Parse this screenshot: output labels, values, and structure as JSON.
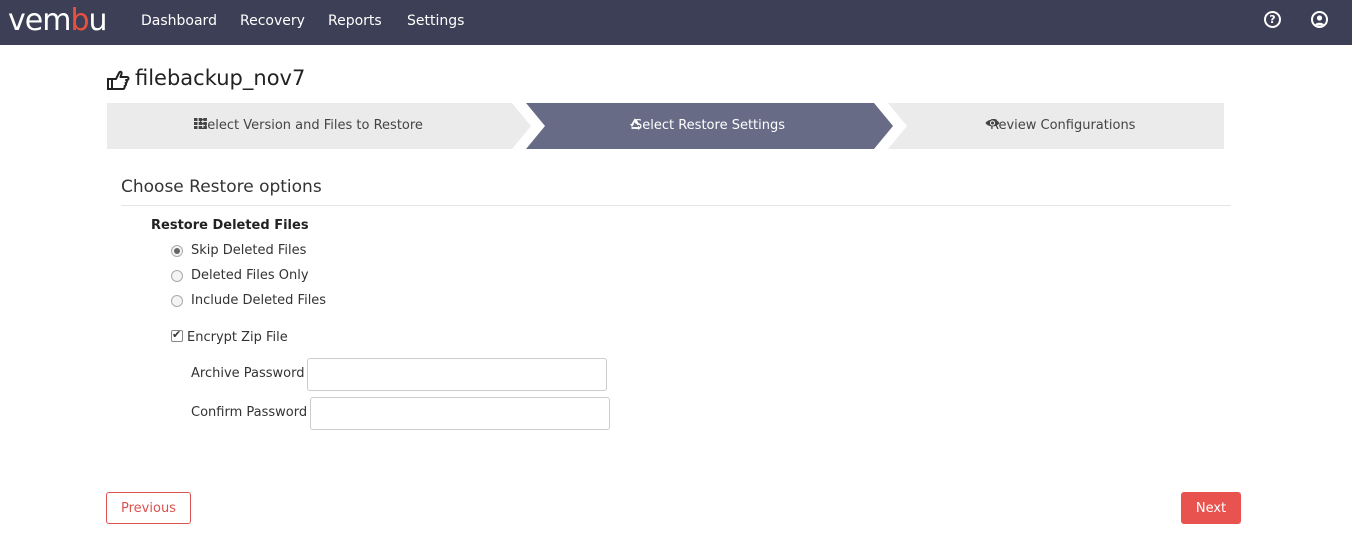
{
  "header": {
    "logo_main": "vem",
    "logo_accent": "b",
    "logo_tail": "u",
    "nav": [
      "Dashboard",
      "Recovery",
      "Reports",
      "Settings"
    ],
    "help_icon": "question-circle-icon",
    "user_icon": "user-circle-icon",
    "accent_color": "#e9513f",
    "bar_color": "#3d3f56"
  },
  "page": {
    "title": "filebackup_nov7",
    "title_icon": "hand-pointing-icon"
  },
  "wizard": {
    "steps": [
      {
        "label": "Select Version and Files to Restore",
        "icon": "grid-icon",
        "active": false
      },
      {
        "label": "Select Restore Settings",
        "icon": "recycle-icon",
        "active": true
      },
      {
        "label": "Review Configurations",
        "icon": "eye-icon",
        "active": false
      }
    ],
    "active_color": "#686b85",
    "inactive_color": "#ebebeb"
  },
  "form": {
    "section_title": "Choose Restore options",
    "group_label": "Restore Deleted Files",
    "options": [
      {
        "label": "Skip Deleted Files",
        "checked": true
      },
      {
        "label": "Deleted Files Only",
        "checked": false
      },
      {
        "label": "Include Deleted Files",
        "checked": false
      }
    ],
    "encrypt_label": "Encrypt Zip File",
    "encrypt_checked": true,
    "archive_password_label": "Archive Password",
    "archive_password_value": "",
    "confirm_password_label": "Confirm Password",
    "confirm_password_value": ""
  },
  "footer": {
    "previous_label": "Previous",
    "next_label": "Next"
  }
}
